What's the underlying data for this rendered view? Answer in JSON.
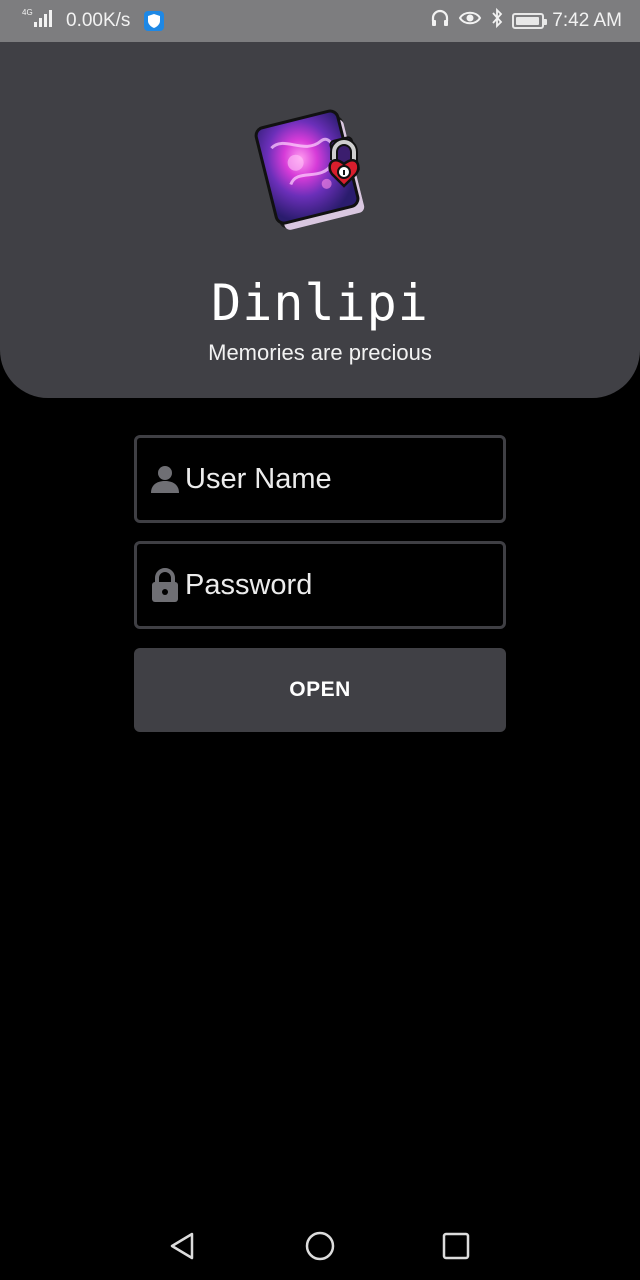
{
  "status_bar": {
    "network": "4G",
    "speed": "0.00K/s",
    "time": "7:42 AM",
    "battery_level": 0.95
  },
  "header": {
    "app_name": "Dinlipi",
    "tagline": "Memories are precious"
  },
  "login": {
    "username_placeholder": "User Name",
    "password_placeholder": "Password",
    "open_label": "OPEN"
  },
  "icons": {
    "user": "person-icon",
    "password": "lock-icon"
  },
  "colors": {
    "header_bg": "#404045",
    "field_border": "#3f3f44",
    "button_bg": "#404045",
    "status_bar_bg": "#7d7d7f"
  }
}
